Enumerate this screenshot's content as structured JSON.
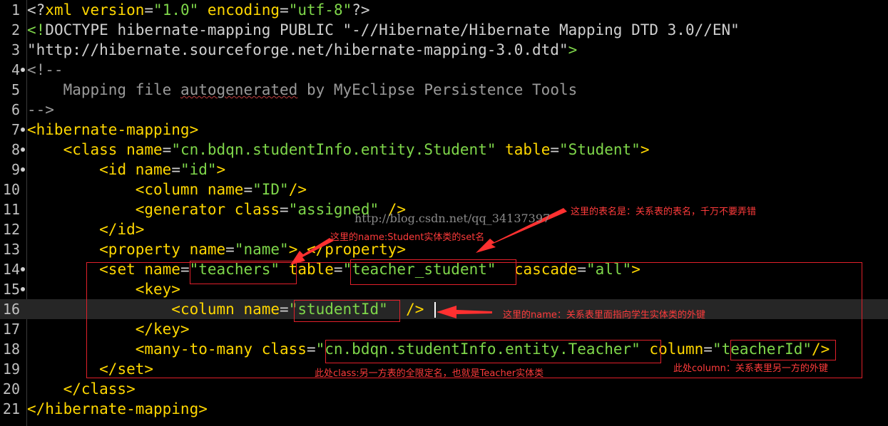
{
  "editor": {
    "lines": [
      {
        "n": "1",
        "fold": false,
        "current": false,
        "segs": [
          [
            "t",
            "<?"
          ],
          [
            "tg",
            "xml "
          ],
          [
            "at",
            "version"
          ],
          [
            "t",
            "="
          ],
          [
            "s",
            "\"1.0\""
          ],
          [
            "t",
            " "
          ],
          [
            "at",
            "encoding"
          ],
          [
            "t",
            "="
          ],
          [
            "s",
            "\"utf-8\""
          ],
          [
            "t",
            "?>"
          ]
        ]
      },
      {
        "n": "2",
        "fold": false,
        "current": false,
        "segs": [
          [
            "s",
            "<!"
          ],
          [
            "t",
            "DOCTYPE hibernate-mapping PUBLIC \"-//Hibernate/Hibernate Mapping DTD 3.0//EN\""
          ]
        ]
      },
      {
        "n": "3",
        "fold": false,
        "current": false,
        "segs": [
          [
            "t",
            "\"http://hibernate.sourceforge.net/hibernate-mapping-3.0.dtd\""
          ],
          [
            "s",
            ">"
          ]
        ]
      },
      {
        "n": "4",
        "fold": true,
        "current": false,
        "segs": [
          [
            "cm",
            "<!--"
          ]
        ]
      },
      {
        "n": "5",
        "fold": false,
        "current": false,
        "segs": [
          [
            "cm",
            "    Mapping file "
          ],
          [
            "cm squig",
            "autogenerated"
          ],
          [
            "cm",
            " by MyEclipse Persistence Tools"
          ]
        ]
      },
      {
        "n": "6",
        "fold": false,
        "current": false,
        "segs": [
          [
            "cm",
            "-->"
          ]
        ]
      },
      {
        "n": "7",
        "fold": true,
        "current": false,
        "segs": [
          [
            "tg",
            "<hibernate-mapping>"
          ]
        ]
      },
      {
        "n": "8",
        "fold": true,
        "current": false,
        "segs": [
          [
            "t",
            "    "
          ],
          [
            "tg",
            "<class "
          ],
          [
            "at",
            "name"
          ],
          [
            "t",
            "="
          ],
          [
            "s",
            "\"cn.bdqn.studentInfo.entity.Student\""
          ],
          [
            "t",
            " "
          ],
          [
            "at",
            "table"
          ],
          [
            "t",
            "="
          ],
          [
            "s",
            "\"Student\""
          ],
          [
            "tg",
            ">"
          ]
        ]
      },
      {
        "n": "9",
        "fold": true,
        "current": false,
        "segs": [
          [
            "t",
            "        "
          ],
          [
            "tg",
            "<id "
          ],
          [
            "at",
            "name"
          ],
          [
            "t",
            "="
          ],
          [
            "s",
            "\"id\""
          ],
          [
            "tg",
            ">"
          ]
        ]
      },
      {
        "n": "10",
        "fold": false,
        "current": false,
        "segs": [
          [
            "t",
            "            "
          ],
          [
            "tg",
            "<column "
          ],
          [
            "at",
            "name"
          ],
          [
            "t",
            "="
          ],
          [
            "s",
            "\"ID\""
          ],
          [
            "tg",
            "/>"
          ]
        ]
      },
      {
        "n": "11",
        "fold": false,
        "current": false,
        "segs": [
          [
            "t",
            "            "
          ],
          [
            "tg",
            "<generator "
          ],
          [
            "at",
            "class"
          ],
          [
            "t",
            "="
          ],
          [
            "s",
            "\"assigned\""
          ],
          [
            "t",
            " "
          ],
          [
            "tg",
            "/>"
          ]
        ]
      },
      {
        "n": "12",
        "fold": false,
        "current": false,
        "segs": [
          [
            "t",
            "        "
          ],
          [
            "tg",
            "</id>"
          ]
        ]
      },
      {
        "n": "13",
        "fold": false,
        "current": false,
        "segs": [
          [
            "t",
            "        "
          ],
          [
            "tg",
            "<property "
          ],
          [
            "at",
            "name"
          ],
          [
            "t",
            "="
          ],
          [
            "s",
            "\"name\""
          ],
          [
            "tg",
            ">"
          ],
          [
            "t",
            " "
          ],
          [
            "tg",
            "</property>"
          ]
        ]
      },
      {
        "n": "14",
        "fold": true,
        "current": false,
        "segs": [
          [
            "t",
            "        "
          ],
          [
            "tg",
            "<set "
          ],
          [
            "at",
            "name"
          ],
          [
            "t",
            "="
          ],
          [
            "s",
            "\"teachers\""
          ],
          [
            "t",
            " "
          ],
          [
            "at",
            "table"
          ],
          [
            "t",
            "="
          ],
          [
            "s",
            "\"teacher_student\""
          ],
          [
            "t",
            "  "
          ],
          [
            "at",
            "cascade"
          ],
          [
            "t",
            "="
          ],
          [
            "s",
            "\"all\""
          ],
          [
            "tg",
            ">"
          ]
        ]
      },
      {
        "n": "15",
        "fold": true,
        "current": false,
        "segs": [
          [
            "t",
            "            "
          ],
          [
            "tg",
            "<key>"
          ]
        ]
      },
      {
        "n": "16",
        "fold": false,
        "current": true,
        "segs": [
          [
            "t",
            "                "
          ],
          [
            "tg",
            "<column "
          ],
          [
            "at",
            "name"
          ],
          [
            "t",
            "="
          ],
          [
            "s",
            "\"studentId\""
          ],
          [
            "t",
            "  "
          ],
          [
            "tg",
            "/>"
          ]
        ]
      },
      {
        "n": "17",
        "fold": false,
        "current": false,
        "segs": [
          [
            "t",
            "            "
          ],
          [
            "tg",
            "</key>"
          ]
        ]
      },
      {
        "n": "18",
        "fold": false,
        "current": false,
        "segs": [
          [
            "t",
            "            "
          ],
          [
            "tg",
            "<many-to-many "
          ],
          [
            "at",
            "class"
          ],
          [
            "t",
            "="
          ],
          [
            "s",
            "\"cn.bdqn.studentInfo.entity.Teacher\""
          ],
          [
            "t",
            " "
          ],
          [
            "at",
            "column"
          ],
          [
            "t",
            "="
          ],
          [
            "s",
            "\"teacherId\""
          ],
          [
            "tg",
            "/>"
          ]
        ]
      },
      {
        "n": "19",
        "fold": false,
        "current": false,
        "segs": [
          [
            "t",
            "        "
          ],
          [
            "tg",
            "</set>"
          ]
        ]
      },
      {
        "n": "20",
        "fold": false,
        "current": false,
        "segs": [
          [
            "t",
            "    "
          ],
          [
            "tg",
            "</class>"
          ]
        ]
      },
      {
        "n": "21",
        "fold": false,
        "current": false,
        "segs": [
          [
            "tg",
            "</hibernate-mapping>"
          ]
        ]
      }
    ]
  },
  "annotations": {
    "watermark": "http://blog.csdn.net/qq_34137397",
    "note_table": "这里的表名是：关系表的表名，千万不要弄错",
    "note_set_name": "这里的name:Student实体类的set名",
    "note_key_column": "这里的name：关系表里面指向学生实体类的外键",
    "note_class": "此处class:另一方表的全限定名，也就是Teacher实体类",
    "note_column": "此处column：关系表里另一方的外键"
  },
  "colors": {
    "background": "#000000",
    "tag": "#ffd700",
    "string": "#7fd74a",
    "comment": "#9a9a9a",
    "annotation": "#e0202a"
  }
}
